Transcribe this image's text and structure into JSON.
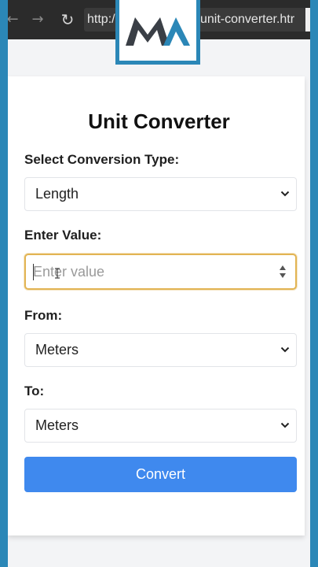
{
  "browser": {
    "url_prefix": "http:/",
    "url_suffix": "unit-converter.htr"
  },
  "form": {
    "title": "Unit Converter",
    "type_label": "Select Conversion Type:",
    "type_value": "Length",
    "value_label": "Enter Value:",
    "value_placeholder": "Enter value",
    "from_label": "From:",
    "from_value": "Meters",
    "to_label": "To:",
    "to_value": "Meters",
    "convert_label": "Convert"
  },
  "colors": {
    "frame": "#2b87b7",
    "button": "#3f89ee",
    "focus_border": "#e2b454"
  }
}
